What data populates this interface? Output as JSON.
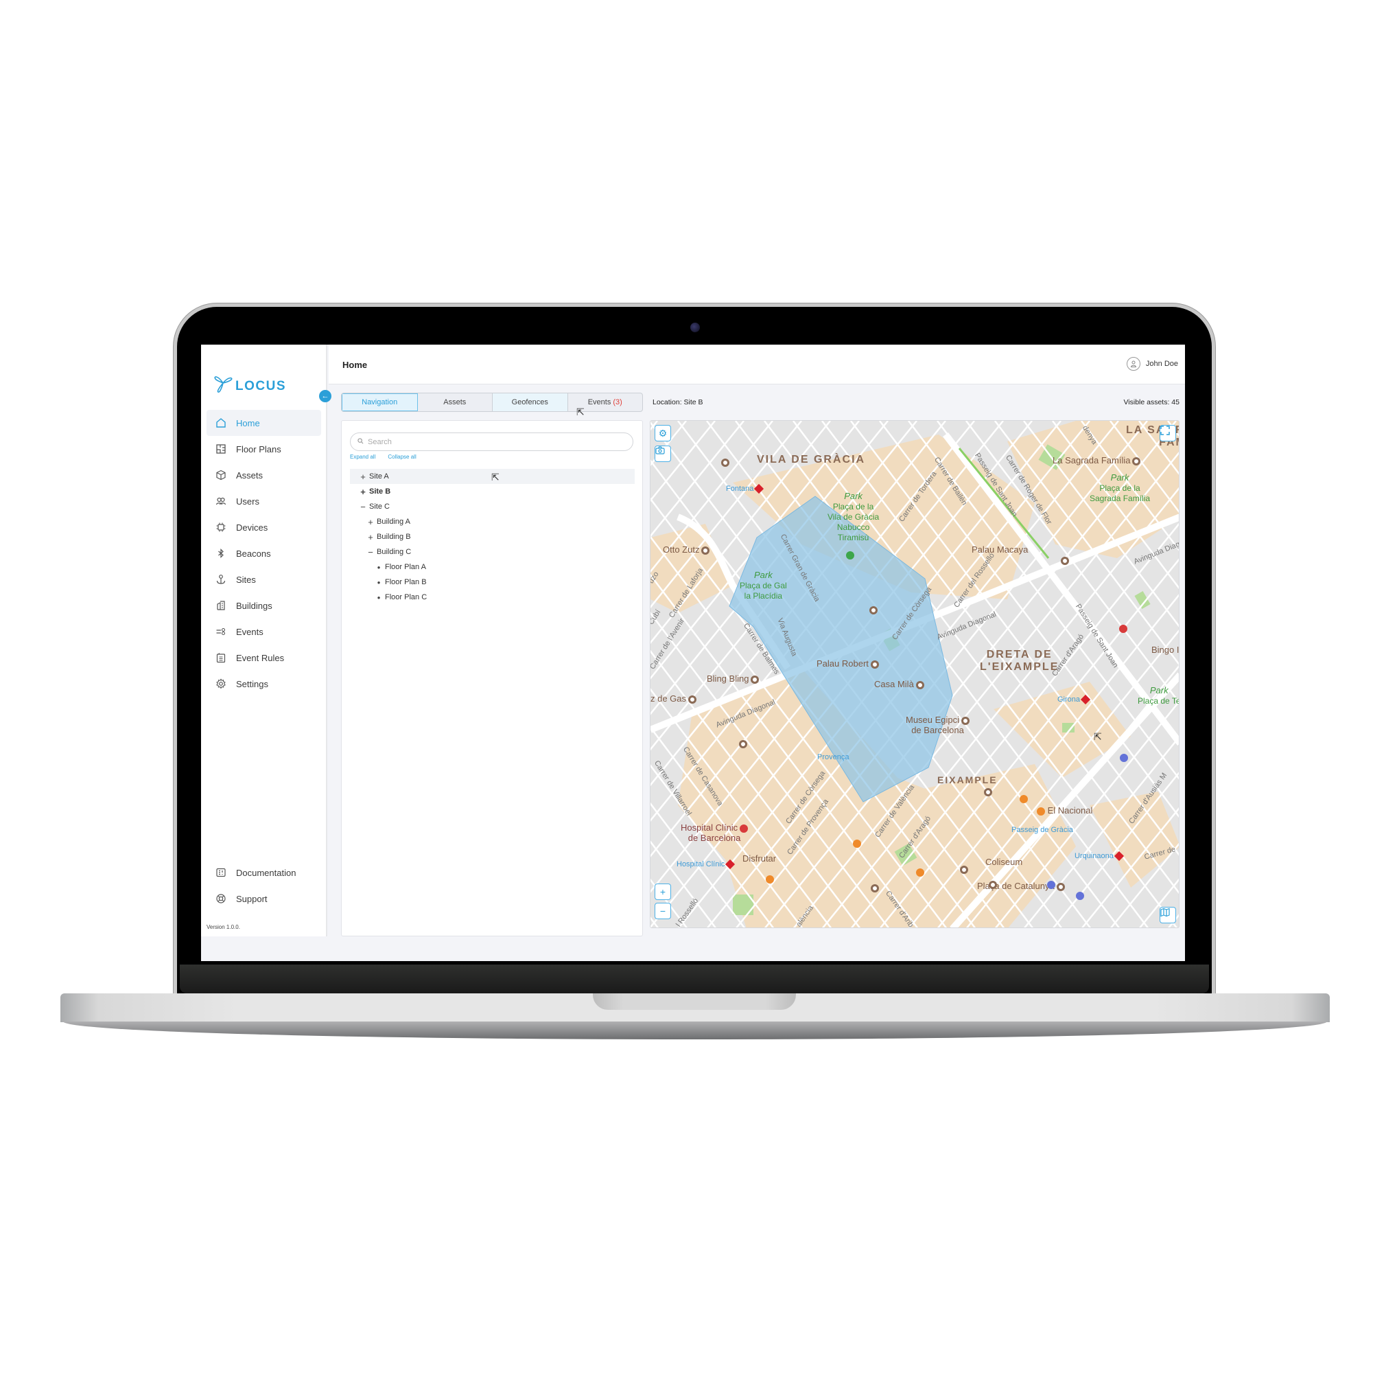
{
  "app": {
    "logo_text": "LOCUS",
    "version": "Version 1.0.0."
  },
  "sidebar": {
    "items": [
      {
        "label": "Home",
        "icon": "home-icon",
        "active": true
      },
      {
        "label": "Floor Plans",
        "icon": "floor-plan-icon"
      },
      {
        "label": "Assets",
        "icon": "cube-icon"
      },
      {
        "label": "Users",
        "icon": "users-icon"
      },
      {
        "label": "Devices",
        "icon": "chip-icon"
      },
      {
        "label": "Beacons",
        "icon": "bluetooth-icon"
      },
      {
        "label": "Sites",
        "icon": "anchor-icon"
      },
      {
        "label": "Buildings",
        "icon": "building-icon"
      },
      {
        "label": "Events",
        "icon": "events-icon"
      },
      {
        "label": "Event Rules",
        "icon": "clipboard-icon"
      },
      {
        "label": "Settings",
        "icon": "gear-icon"
      }
    ],
    "bottom_items": [
      {
        "label": "Documentation",
        "icon": "documentation-icon"
      },
      {
        "label": "Support",
        "icon": "lifebuoy-icon"
      }
    ]
  },
  "header": {
    "title": "Home",
    "user_name": "John Doe"
  },
  "tabs": [
    {
      "label": "Navigation",
      "active": true
    },
    {
      "label": "Assets"
    },
    {
      "label": "Geofences"
    },
    {
      "label": "Events",
      "badge": "(3)"
    }
  ],
  "status": {
    "location": "Location: Site B",
    "visible_assets": "Visible assets: 45"
  },
  "tree": {
    "search_placeholder": "Search",
    "expand_all": "Expand all",
    "collapse_all": "Collapse all",
    "nodes": [
      {
        "label": "Site A",
        "toggle": "+",
        "level": 0
      },
      {
        "label": "Site B",
        "toggle": "+",
        "level": 0,
        "bold": true
      },
      {
        "label": "Site C",
        "toggle": "−",
        "level": 0
      },
      {
        "label": "Building A",
        "toggle": "+",
        "level": 1
      },
      {
        "label": "Building B",
        "toggle": "+",
        "level": 1
      },
      {
        "label": "Building C",
        "toggle": "−",
        "level": 1
      },
      {
        "label": "Floor Plan A",
        "toggle": "•",
        "level": 2
      },
      {
        "label": "Floor Plan B",
        "toggle": "•",
        "level": 2
      },
      {
        "label": "Floor Plan C",
        "toggle": "•",
        "level": 2
      }
    ]
  },
  "map": {
    "districts": [
      "VILA DE GRÀCIA",
      "DRETA DE",
      "L'EIXAMPLE",
      "EIXAMPLE",
      "LA SAGRADA",
      "FAMÍLIA"
    ],
    "places": {
      "otto_zutz": "Otto Zutz",
      "palau_robert": "Palau Robert",
      "casa_mila": "Casa Milà",
      "bling_bling": "Bling Bling",
      "luz_de_gas": "z de Gas",
      "museu_1": "Museu Egipci",
      "museu_2": "de Barcelona",
      "sagrada": "La Sagrada Família",
      "palau_macaya": "Palau Macaya",
      "bingo": "Bingo I",
      "el_nacional": "El Nacional",
      "coliseum": "Coliseum",
      "placa_catalunya": "Plaça de Catalunya",
      "hospital_1": "Hospital Clínic",
      "hospital_2": "de Barcelona",
      "disfrutar": "Disfrutar"
    },
    "parks": {
      "gracia": [
        "Park",
        "Plaça de la",
        "Vila de Gràcia",
        "Nabucco",
        "Tiramisù"
      ],
      "gal": [
        "Park",
        "Plaça de Gal",
        "la Placídia"
      ],
      "sagrada": [
        "Park",
        "Plaça de la",
        "Sagrada Família"
      ],
      "tetuan": [
        "Park",
        "Plaça de Te"
      ]
    },
    "metro": {
      "fontana": "Fontana",
      "provenca": "Provença",
      "girona": "Girona",
      "passeig_gracia": "Passeig de Gràcia",
      "urquinaona": "Urquinaona",
      "hospital_clinic": "Hospital Clínic"
    },
    "streets": {
      "gran_gracia": "Carrer Gran de Gràcia",
      "balmes": "Carrer de Balmes",
      "via_augusta": "Via Augusta",
      "diagonal_1": "Avinguda Diagonal",
      "diagonal_2": "Avinguda Diagonal",
      "diagonal_3": "Avinguda Diag",
      "corsega": "Carrer de Còrsega",
      "corsega_2": "Carrer de Còrsega",
      "rossello": "Carrer del Rosselló",
      "bailen": "Carrer de Bailèn",
      "sant_joan": "Passeig de Sant Joan",
      "sant_joan_2": "Passeig de Sant Joan",
      "roger_flor": "Carrer de Roger de Flor",
      "arago": "Carrer d'Aragó",
      "arago_2": "Carrer d'Aragó",
      "valencia": "Carrer de València",
      "provenca": "Carrer de Provença",
      "casanova": "Carrer de Casanova",
      "villarroel": "Carrer de Villarroel",
      "laforja": "Carrer de Laforja",
      "avenir": "Carrer de l'Avenir",
      "ausias": "Carrer d'Ausiàs M",
      "carrer_de": "Carrer de",
      "aribau": "Carrer d'Arib",
      "tordera": "Carrer de Tordera",
      "denya": "denya",
      "cubi": "Cubí",
      "uzo": "uzo",
      "rossello_2": "l Rosselló",
      "valencia_2": "alència"
    },
    "geofence_color": "#8fc5e6"
  },
  "colors": {
    "accent": "#2b9fd8",
    "badge": "#e0403a"
  }
}
